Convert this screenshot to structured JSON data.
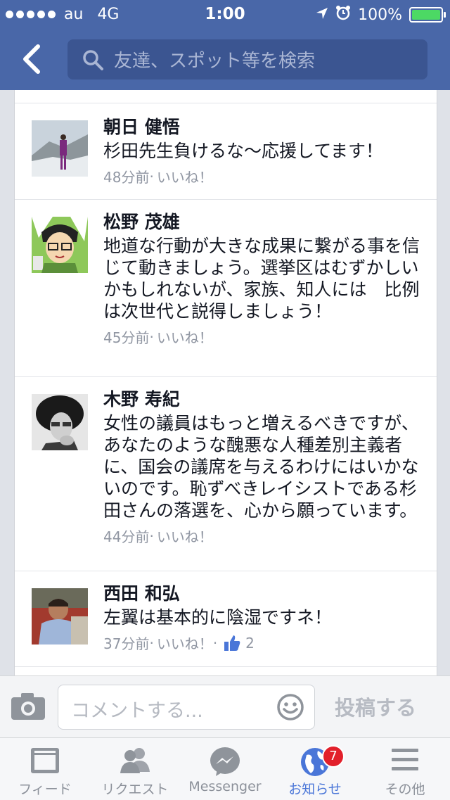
{
  "status_bar": {
    "carrier": "au",
    "network": "4G",
    "time": "1:00",
    "battery": "100%"
  },
  "search": {
    "placeholder": "友達、スポット等を検索"
  },
  "comments": [
    {
      "name": "朝日 健悟",
      "text": "杉田先生負けるな〜応援してます！",
      "time": "48分前",
      "separator": " · ",
      "like": "いいね！"
    },
    {
      "name": "松野 茂雄",
      "text": "地道な行動が大きな成果に繋がる事を信じて動きましょう。選挙区はむずかしいかもしれないが、家族、知人には　比例は次世代と説得しましょう！",
      "time": "45分前",
      "separator": " · ",
      "like": "いいね！"
    },
    {
      "name": "木野 寿紀",
      "text": "女性の議員はもっと増えるべきですが、あなたのような醜悪な人種差別主義者に、国会の議席を与えるわけにはいかないのです。恥ずべきレイシストである杉田さんの落選を、心から願っています。",
      "time": "44分前",
      "separator": " · ",
      "like": "いいね！"
    },
    {
      "name": "西田 和弘",
      "text": "左翼は基本的に陰湿ですネ！",
      "time": "37分前",
      "separator": " · ",
      "like": "いいね！",
      "like_separator": " · ",
      "like_count": "2"
    }
  ],
  "comment_bar": {
    "placeholder": "コメントする...",
    "post_label": "投稿する"
  },
  "tabs": [
    {
      "label": "フィード",
      "icon": "feed-icon"
    },
    {
      "label": "リクエスト",
      "icon": "friend-requests-icon"
    },
    {
      "label": "Messenger",
      "icon": "messenger-icon"
    },
    {
      "label": "お知らせ",
      "icon": "notifications-globe-icon",
      "badge": "7",
      "active": true
    },
    {
      "label": "その他",
      "icon": "menu-icon"
    }
  ],
  "colors": {
    "header": "#4967a8",
    "accent": "#4a76d8",
    "badge": "#e2202b",
    "battery": "#4cd964"
  }
}
